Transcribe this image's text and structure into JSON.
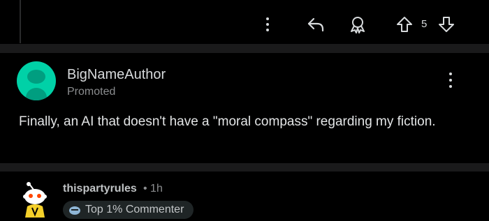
{
  "topbar": {
    "vote_count": "5",
    "icons": [
      "more-vertical-icon",
      "reply-icon",
      "award-icon",
      "upvote-icon",
      "downvote-icon"
    ]
  },
  "post": {
    "author": "BigNameAuthor",
    "label": "Promoted",
    "body": "Finally, an AI that doesn't have a \"moral compass\" regarding my fiction."
  },
  "comment": {
    "username": "thispartyrules",
    "time": "• 1h",
    "badge": "Top 1% Commenter"
  },
  "colors": {
    "background": "#000000",
    "divider": "#1a1a1b",
    "avatar": "#00d1a7",
    "text": "#d7dadc",
    "muted": "#8b8d8f"
  }
}
